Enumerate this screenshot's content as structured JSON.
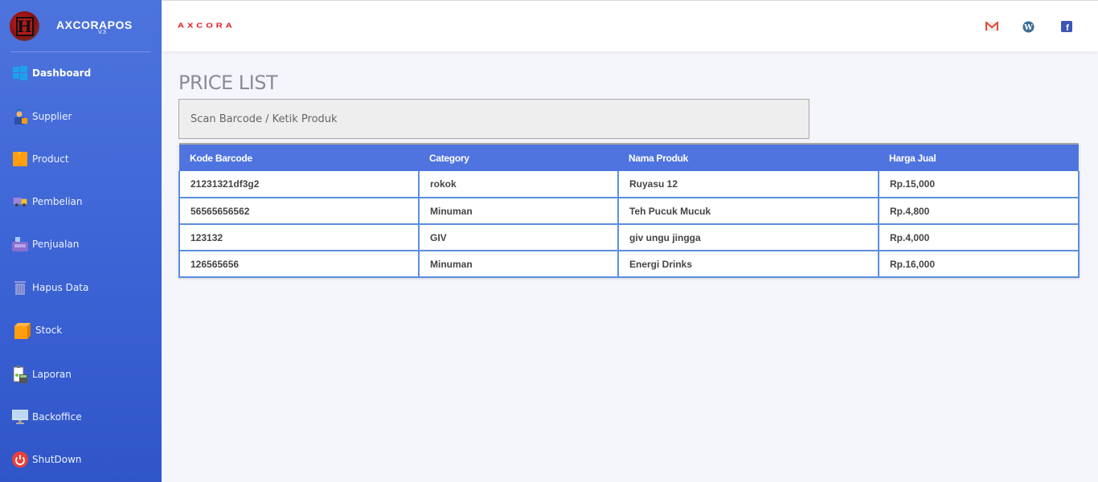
{
  "app": {
    "name": "AXCORAPOS",
    "version": "V.3",
    "logo_letter": "H",
    "header_logo_text": "AXCORA"
  },
  "sidebar": {
    "items": [
      {
        "label": "Dashboard",
        "icon": "windows-icon",
        "active": true
      },
      {
        "label": "Supplier",
        "icon": "supplier-person-icon",
        "active": false
      },
      {
        "label": "Product",
        "icon": "box-icon",
        "active": false
      },
      {
        "label": "Pembelian",
        "icon": "delivery-truck-icon",
        "active": false
      },
      {
        "label": "Penjualan",
        "icon": "cash-register-icon",
        "active": false
      },
      {
        "label": "Hapus Data",
        "icon": "trash-icon",
        "active": false
      },
      {
        "label": "Stock",
        "icon": "package-icon",
        "active": false
      },
      {
        "label": "Laporan",
        "icon": "report-calculator-icon",
        "active": false
      },
      {
        "label": "Backoffice",
        "icon": "monitor-icon",
        "active": false
      },
      {
        "label": "ShutDown",
        "icon": "power-icon",
        "active": false
      }
    ]
  },
  "topbar": {
    "icons": [
      "gmail-icon",
      "wordpress-icon",
      "facebook-icon"
    ]
  },
  "main": {
    "title": "PRICE LIST",
    "search": {
      "placeholder": "Scan Barcode / Ketik Produk",
      "value": ""
    },
    "table": {
      "headers": [
        "Kode Barcode",
        "Category",
        "Nama Produk",
        "Harga Jual"
      ],
      "rows": [
        [
          "21231321df3g2",
          "rokok",
          "Ruyasu 12",
          "Rp.15,000"
        ],
        [
          "56565656562",
          "Minuman",
          "Teh Pucuk Mucuk",
          "Rp.4,800"
        ],
        [
          "123132",
          "GIV",
          "giv ungu jingga",
          "Rp.4,000"
        ],
        [
          "126565656",
          "Minuman",
          "Energi Drinks",
          "Rp.16,000"
        ]
      ]
    }
  },
  "colors": {
    "sidebar_top": "#4d74dd",
    "sidebar_bottom": "#2f55c9",
    "table_header": "#4f74df",
    "table_border": "#5b8fe0",
    "brand_red": "#e0161b"
  }
}
